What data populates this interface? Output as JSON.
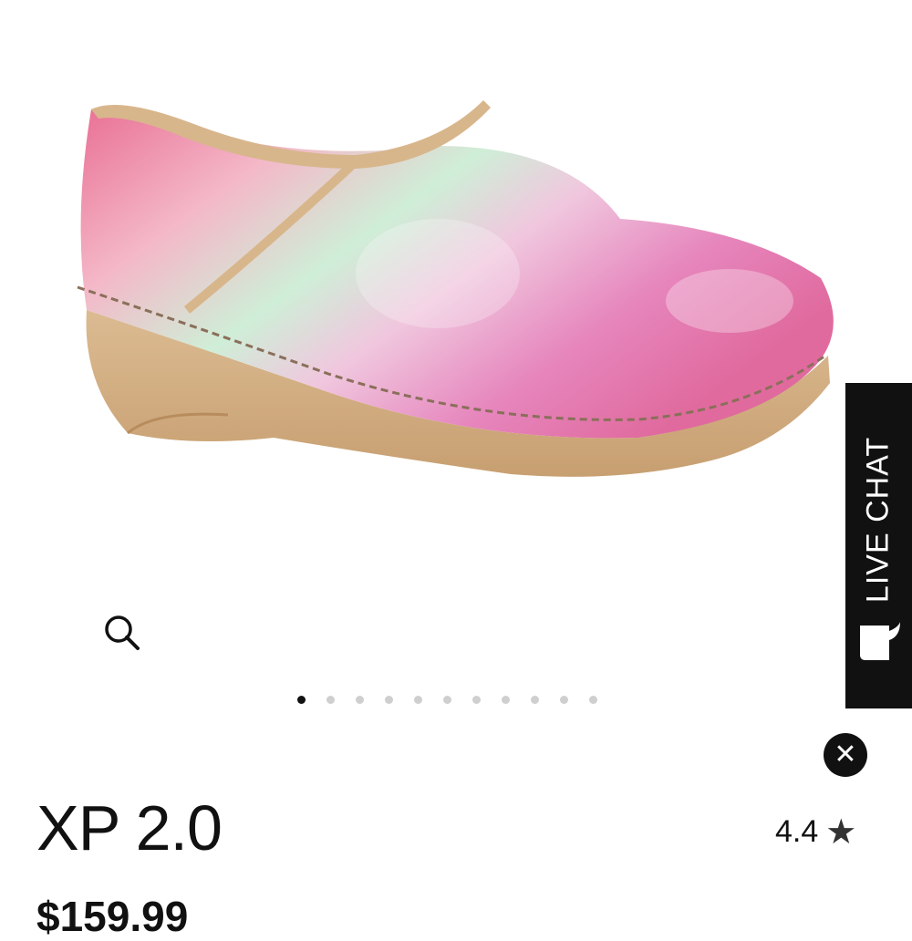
{
  "product": {
    "name": "XP 2.0",
    "rating": "4.4",
    "price": "$159.99",
    "image_icon": "pink-iridescent-clog"
  },
  "gallery": {
    "dot_count": 11,
    "active_index": 0,
    "zoom_icon": "search-icon"
  },
  "live_chat": {
    "label": "LIVE CHAT",
    "icon": "chat-bubble-icon"
  },
  "close_icon": "close-icon",
  "colors": {
    "accent": "#111111",
    "dot_inactive": "#cfcfcf",
    "shoe_pink": "#e889b0",
    "sole_tan": "#cfa87c"
  }
}
